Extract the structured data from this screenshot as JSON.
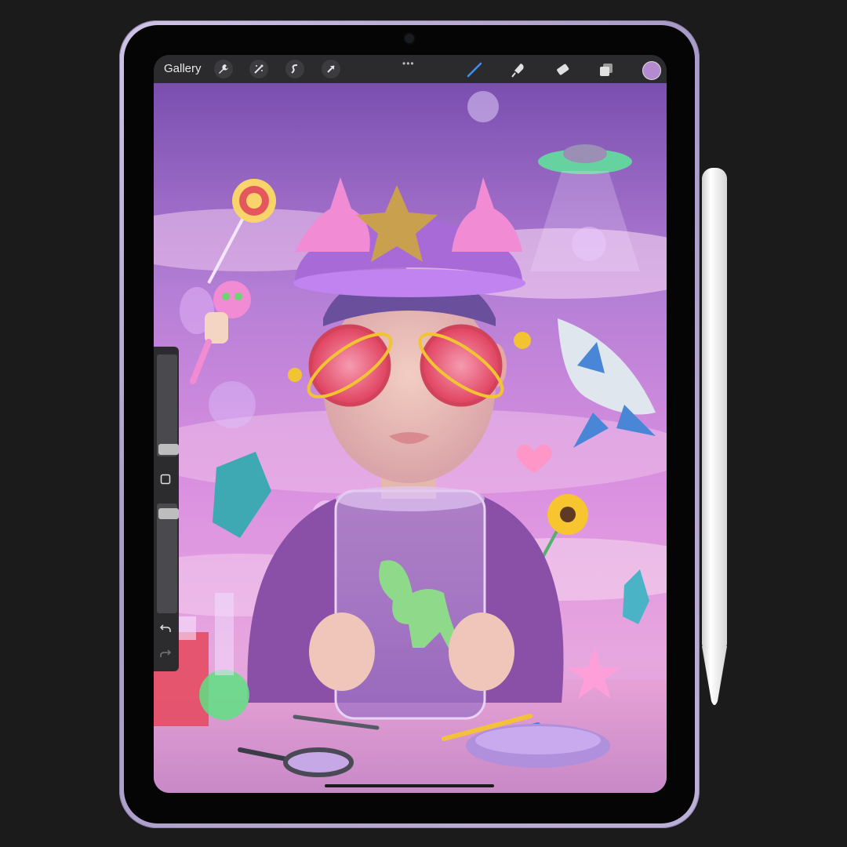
{
  "app": {
    "toolbar": {
      "gallery_label": "Gallery",
      "left_icons": [
        "wrench-icon",
        "magic-wand-icon",
        "selection-icon",
        "transform-arrow-icon"
      ],
      "right_tools": [
        "brush-icon",
        "smudge-icon",
        "eraser-icon",
        "layers-icon"
      ],
      "active_tool": "brush-icon",
      "current_color": "#b48ad0"
    },
    "sidebar": {
      "modify_button_icon": "square-icon",
      "undo_icon": "undo-icon",
      "redo_icon": "redo-icon"
    }
  },
  "device": {
    "frame_color": "#bcaed8",
    "accessory": "stylus-pencil"
  }
}
